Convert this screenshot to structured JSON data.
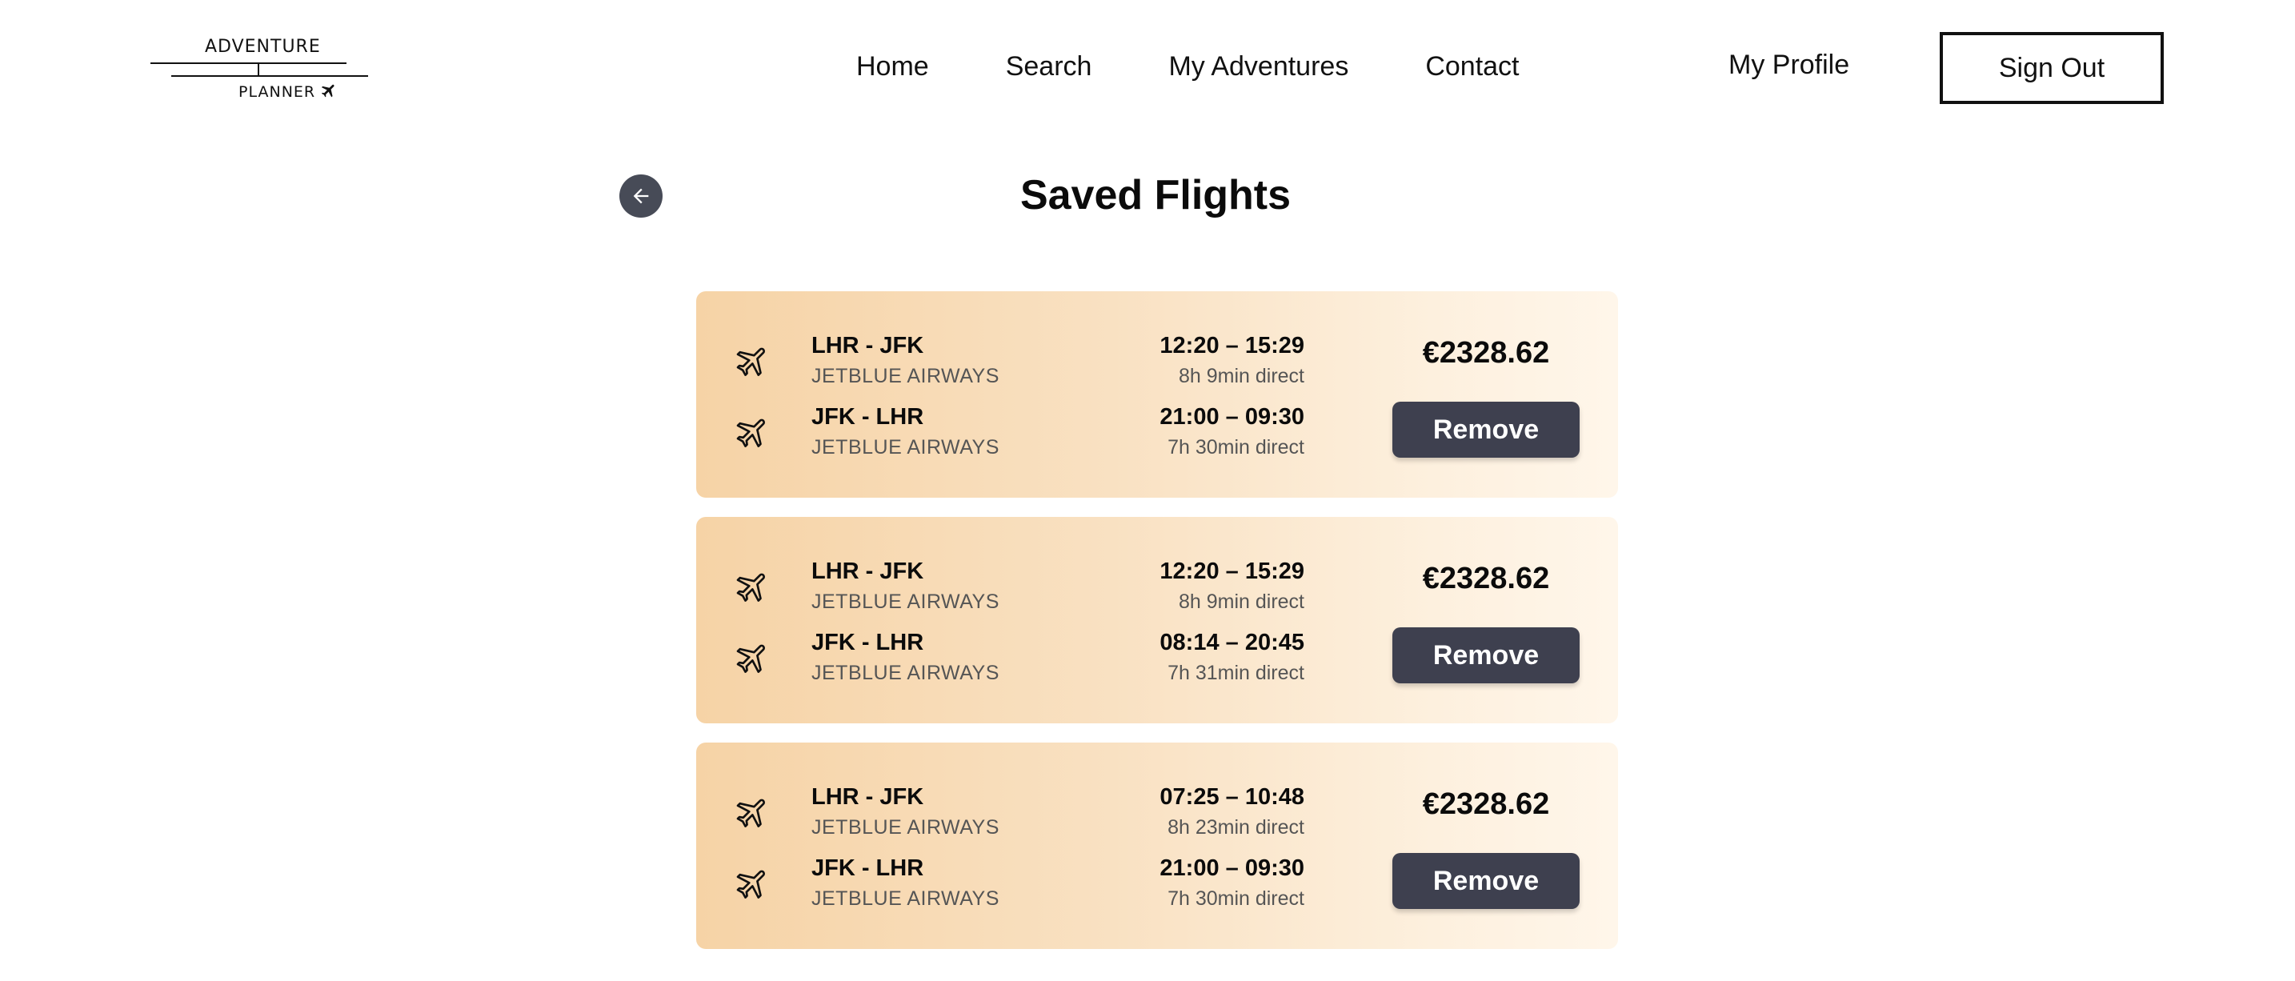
{
  "logo": {
    "line1": "ADVENTURE",
    "line2": "PLANNER"
  },
  "nav": {
    "items": [
      {
        "label": "Home"
      },
      {
        "label": "Search"
      },
      {
        "label": "My Adventures"
      },
      {
        "label": "Contact"
      }
    ],
    "profile": "My Profile",
    "sign_out": "Sign Out"
  },
  "page": {
    "title": "Saved Flights"
  },
  "flights": [
    {
      "outbound": {
        "route": "LHR - JFK",
        "airline": "JETBLUE AIRWAYS",
        "times": "12:20 – 15:29",
        "duration": "8h 9min direct"
      },
      "return": {
        "route": "JFK - LHR",
        "airline": "JETBLUE AIRWAYS",
        "times": "21:00 – 09:30",
        "duration": "7h 30min direct"
      },
      "price": "€2328.62",
      "remove_label": "Remove"
    },
    {
      "outbound": {
        "route": "LHR - JFK",
        "airline": "JETBLUE AIRWAYS",
        "times": "12:20 – 15:29",
        "duration": "8h 9min direct"
      },
      "return": {
        "route": "JFK - LHR",
        "airline": "JETBLUE AIRWAYS",
        "times": "08:14 – 20:45",
        "duration": "7h 31min direct"
      },
      "price": "€2328.62",
      "remove_label": "Remove"
    },
    {
      "outbound": {
        "route": "LHR - JFK",
        "airline": "JETBLUE AIRWAYS",
        "times": "07:25 – 10:48",
        "duration": "8h 23min direct"
      },
      "return": {
        "route": "JFK - LHR",
        "airline": "JETBLUE AIRWAYS",
        "times": "21:00 – 09:30",
        "duration": "7h 30min direct"
      },
      "price": "€2328.62",
      "remove_label": "Remove"
    }
  ],
  "colors": {
    "button": "#3e404f",
    "back_button": "#474b57",
    "card_start": "#f6d3a6",
    "card_end": "#fff6ea"
  },
  "icons": {
    "back": "arrow-left-icon",
    "flight": "airplane-icon"
  }
}
